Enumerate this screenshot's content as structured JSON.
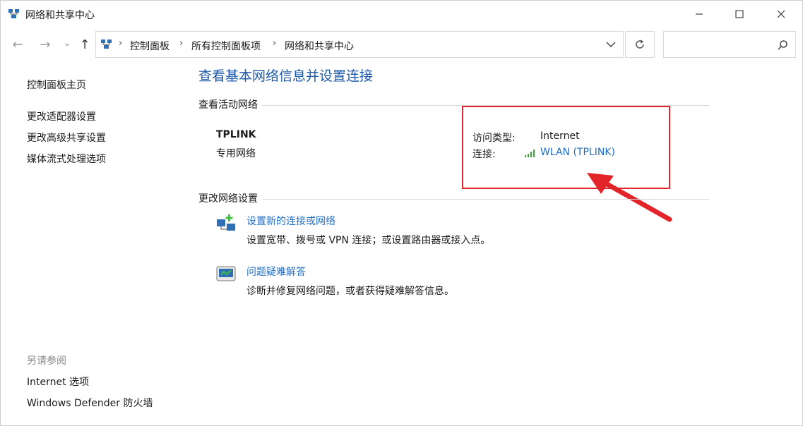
{
  "window": {
    "title": "网络和共享中心"
  },
  "nav": {
    "back": "←",
    "forward": "→",
    "recent": "⌄",
    "up": "↑"
  },
  "address": {
    "crumbs": [
      "控制面板",
      "所有控制面板项",
      "网络和共享中心"
    ],
    "separator": "›"
  },
  "search": {
    "placeholder": ""
  },
  "sidebar": {
    "home": "控制面板主页",
    "items": [
      "更改适配器设置",
      "更改高级共享设置",
      "媒体流式处理选项"
    ],
    "see_also_title": "另请参阅",
    "see_also": [
      "Internet 选项",
      "Windows Defender 防火墙"
    ]
  },
  "main": {
    "title": "查看基本网络信息并设置连接",
    "active_section": "查看活动网络",
    "network_name": "TPLINK",
    "network_type": "专用网络",
    "access_type_label": "访问类型:",
    "access_type_value": "Internet",
    "connection_label": "连接:",
    "connection_value": "WLAN (TPLINK)",
    "change_section": "更改网络设置",
    "tasks": [
      {
        "title": "设置新的连接或网络",
        "desc": "设置宽带、拨号或 VPN 连接；或设置路由器或接入点。"
      },
      {
        "title": "问题疑难解答",
        "desc": "诊断并修复网络问题，或者获得疑难解答信息。"
      }
    ]
  },
  "colors": {
    "link": "#1e6fc8",
    "title": "#1e5aa8",
    "annotation": "#e2242b"
  }
}
